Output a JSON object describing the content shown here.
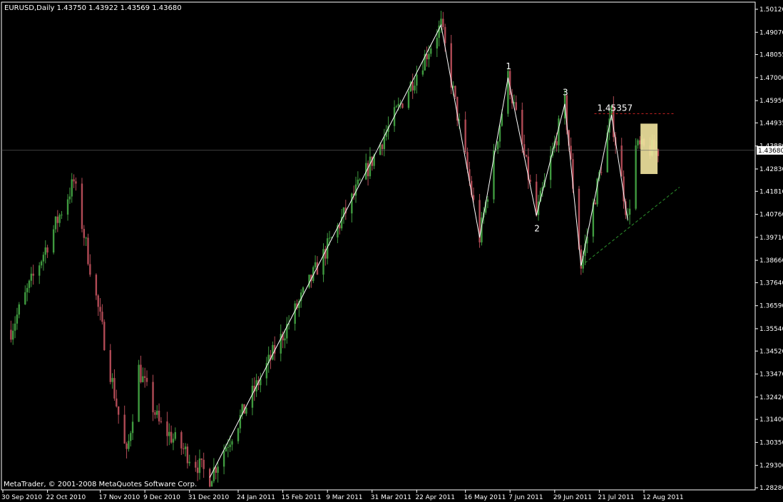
{
  "header": {
    "symbol_info": "EURUSD,Daily  1.43750 1.43922 1.43569 1.43680"
  },
  "footer": {
    "copyright": "MetaTrader, © 2001-2008 MetaQuotes Software Corp."
  },
  "colors": {
    "background": "#000000",
    "frame": "#ffffff",
    "bull_candle": "#3f9a3f",
    "bear_candle": "#b04a55",
    "wave_line": "#ffffff",
    "resistance_line": "#cc2222",
    "support_line": "#2a8a2a",
    "highlight_box": "#f2e6a0",
    "current_price_tag": "#ffffff"
  },
  "chart_data": {
    "type": "candlestick",
    "title": "EURUSD,Daily",
    "ohlc_readout": {
      "open": 1.4375,
      "high": 1.43922,
      "low": 1.43569,
      "close": 1.4368
    },
    "y_ticks": [
      "1.50120",
      "1.49070",
      "1.48055",
      "1.47000",
      "1.45950",
      "1.44935",
      "1.43880",
      "1.42830",
      "1.41810",
      "1.40760",
      "1.39710",
      "1.38660",
      "1.37640",
      "1.36590",
      "1.35540",
      "1.34520",
      "1.33470",
      "1.32420",
      "1.31400",
      "1.30350",
      "1.29300",
      "1.28280"
    ],
    "ylim": [
      1.2828,
      1.5012
    ],
    "current_price": "1.43680",
    "x_ticks": [
      "30 Sep 2010",
      "22 Oct 2010",
      "17 Nov 2010",
      "9 Dec 2010",
      "31 Dec 2010",
      "24 Jan 2011",
      "15 Feb 2011",
      "9 Mar 2011",
      "31 Mar 2011",
      "22 Apr 2011",
      "16 May 2011",
      "7 Jun 2011",
      "29 Jun 2011",
      "21 Jul 2011",
      "12 Aug 2011"
    ],
    "key_points": [
      {
        "date": "4 Oct 2010",
        "price": 1.3549
      },
      {
        "date": "4 Nov 2010",
        "price": 1.4225
      },
      {
        "date": "30 Nov 2010",
        "price": 1.2969
      },
      {
        "date": "6 Dec 2010",
        "price": 1.337
      },
      {
        "date": "16 Dec 2010",
        "price": 1.312
      },
      {
        "date": "10 Jan 2011",
        "price": 1.2875
      },
      {
        "date": "4 May 2011",
        "price": 1.494
      },
      {
        "date": "23 May 2011",
        "price": 1.397
      },
      {
        "date": "6 Jun 2011",
        "price": 1.47
      },
      {
        "date": "20 Jun 2011",
        "price": 1.407
      },
      {
        "date": "4 Jul 2011",
        "price": 1.458
      },
      {
        "date": "12 Jul 2011",
        "price": 1.384
      },
      {
        "date": "27 Jul 2011",
        "price": 1.453
      },
      {
        "date": "4 Aug 2011",
        "price": 1.405
      },
      {
        "date": "8 Aug 2011",
        "price": 1.438
      },
      {
        "date": "19 Aug 2011",
        "price": 1.4368
      }
    ],
    "wave_points": [
      {
        "date": "10 Jan 2011",
        "price": 1.2875
      },
      {
        "date": "4 May 2011",
        "price": 1.494
      },
      {
        "date": "23 May 2011",
        "price": 1.397
      },
      {
        "date": "6 Jun 2011",
        "price": 1.47
      },
      {
        "date": "20 Jun 2011",
        "price": 1.407
      },
      {
        "date": "4 Jul 2011",
        "price": 1.458
      },
      {
        "date": "12 Jul 2011",
        "price": 1.384
      },
      {
        "date": "27 Jul 2011",
        "price": 1.453
      },
      {
        "date": "4 Aug 2011",
        "price": 1.405
      }
    ],
    "wave_labels": [
      {
        "text": "1",
        "date": "6 Jun 2011",
        "price": 1.47
      },
      {
        "text": "2",
        "date": "20 Jun 2011",
        "price": 1.407
      },
      {
        "text": "3",
        "date": "4 Jul 2011",
        "price": 1.458
      }
    ],
    "resistance": {
      "label": "1.45357",
      "value": 1.45357,
      "from_date": "27 Jul 2011",
      "to_date": "19 Aug 2011"
    },
    "support": {
      "from_date": "12 Jul 2011",
      "from_price": 1.384,
      "to_date": "19 Aug 2011",
      "to_price": 1.42
    },
    "highlight": {
      "from_date": "11 Aug 2011",
      "to_date": "18 Aug 2011",
      "top": 1.449,
      "bottom": 1.426
    },
    "grid": false
  }
}
